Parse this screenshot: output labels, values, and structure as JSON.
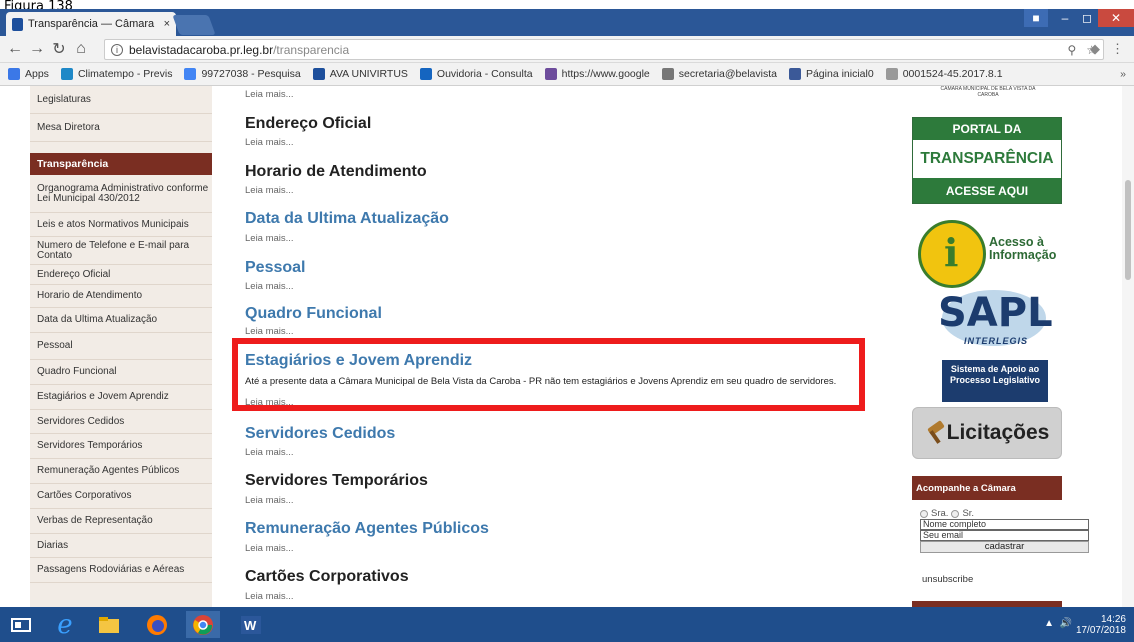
{
  "caption": "Figura 138",
  "browser": {
    "tab_title": "Transparência — Câmara",
    "tab_close": "×",
    "url_domain": "belavistadacaroba.pr.leg.br",
    "url_path": "/transparencia",
    "bookmarks": [
      {
        "label": "Apps",
        "color": "#3b78e7",
        "icon": "apps-icon"
      },
      {
        "label": "Climatempo - Previs",
        "color": "#1e88c7",
        "icon": "climatempo-icon"
      },
      {
        "label": "99727038 - Pesquisa",
        "color": "#4285f4",
        "icon": "google-icon"
      },
      {
        "label": "AVA UNIVIRTUS",
        "color": "#1d4f9c",
        "icon": "univirtus-icon"
      },
      {
        "label": "Ouvidoria - Consulta",
        "color": "#1565c0",
        "icon": "ouvidoria-icon"
      },
      {
        "label": "https://www.google",
        "color": "#6d4c9c",
        "icon": "rs-icon"
      },
      {
        "label": "secretaria@belavista",
        "color": "#777",
        "icon": "mail-icon"
      },
      {
        "label": "Página inicial0",
        "color": "#3b5998",
        "icon": "facebook-icon"
      },
      {
        "label": "0001524-45.2017.8.1",
        "color": "#999",
        "icon": "page-icon"
      }
    ],
    "bookmarks_more": "»"
  },
  "sidebar": {
    "items_top": [
      "Legislaturas",
      "Mesa Diretora"
    ],
    "section_header": "Transparência",
    "items": [
      "Organograma Administrativo conforme Lei Municipal 430/2012",
      "Leis e atos Normativos Municipais",
      "Numero de Telefone e E-mail para Contato",
      "Endereço Oficial",
      "Horario de Atendimento",
      "Data da Ultima Atualização",
      "Pessoal",
      "Quadro Funcional",
      "Estagiários e Jovem Aprendiz",
      "Servidores Cedidos",
      "Servidores Temporários",
      "Remuneração Agentes Públicos",
      "Cartões Corporativos",
      "Verbas de Representação",
      "Diarias",
      "Passagens Rodoviárias e Aéreas"
    ]
  },
  "main": {
    "read_more": "Leia mais...",
    "articles": [
      {
        "title": "Endereço Oficial"
      },
      {
        "title": "Horario de Atendimento"
      },
      {
        "title": "Data da Ultima Atualização"
      },
      {
        "title": "Pessoal"
      },
      {
        "title": "Quadro Funcional"
      },
      {
        "title": "Estagiários e Jovem Aprendiz",
        "description": "Até a presente data a Câmara Municipal de Bela Vista da Caroba - PR não tem estagiários e Jovens Aprendiz em seu quadro de servidores."
      },
      {
        "title": "Servidores Cedidos"
      },
      {
        "title": "Servidores Temporários"
      },
      {
        "title": "Remuneração Agentes Públicos"
      },
      {
        "title": "Cartões Corporativos"
      }
    ]
  },
  "right": {
    "logo_text": "CÂMARA MUNICIPAL DE BELA VISTA DA CAROBA",
    "portal": {
      "top": "PORTAL DA",
      "middle": "TRANSPARÊNCIA",
      "bottom": "ACESSE AQUI"
    },
    "acesso": {
      "line1": "Acesso à",
      "line2": "Informação"
    },
    "sapl": {
      "word": "SAPL",
      "interlegis": "INTERLEGIS",
      "sub": "Sistema de Apoio ao Processo Legislativo"
    },
    "licitacoes": "Licitações",
    "acompanhe": "Acompanhe a Câmara",
    "radio_sra": "Sra.",
    "radio_sr": "Sr.",
    "name_value": "Nome completo",
    "email_value": "Seu email",
    "submit": "cadastrar",
    "unsubscribe": "unsubscribe"
  },
  "taskbar": {
    "time": "14:26",
    "date": "17/07/2018"
  },
  "colors": {
    "accent_red": "#ee1c1c",
    "sidebar_header": "#7a2e22",
    "link_blue": "#3e79ad",
    "portal_green": "#2d7a3b",
    "taskbar": "#1f4e8c"
  }
}
